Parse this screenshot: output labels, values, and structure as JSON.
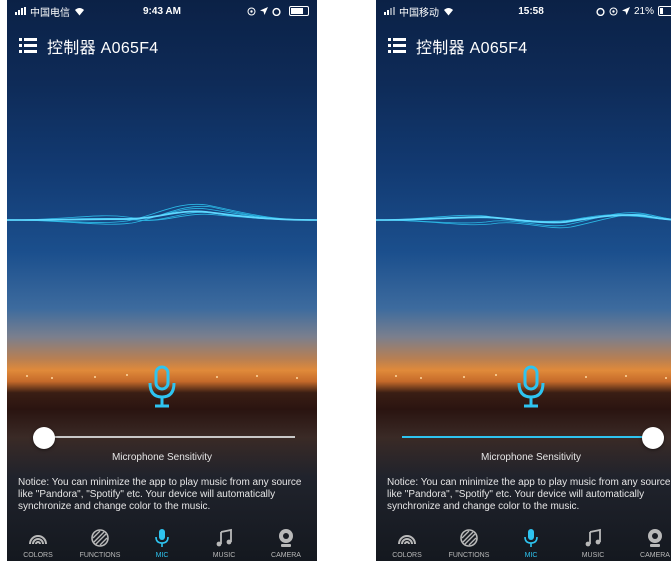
{
  "colors": {
    "accent": "#2ec4f0",
    "tab_inactive": "#b9b9b9",
    "track": "#c8c8c8"
  },
  "screens": [
    {
      "status": {
        "carrier": "中国电信",
        "time": "9:43 AM",
        "battery_percent": "",
        "battery_level": 0.85
      },
      "header": {
        "title": "控制器 A065F4",
        "menu_icon": "list-icon"
      },
      "mic": {
        "icon": "microphone-icon",
        "sensitivity_label": "Microphone Sensitivity",
        "sensitivity": 0.0
      },
      "notice": "Notice: You can minimize the app to play music from any source like \"Pandora\", \"Spotify\" etc. Your device will automatically synchronize and change color to the music.",
      "tabs": [
        {
          "label": "COLORS",
          "icon": "rainbow-icon",
          "active": false
        },
        {
          "label": "FUNCTIONS",
          "icon": "striped-circle-icon",
          "active": false
        },
        {
          "label": "MIC",
          "icon": "microphone-icon",
          "active": true
        },
        {
          "label": "MUSIC",
          "icon": "music-note-icon",
          "active": false
        },
        {
          "label": "CAMERA",
          "icon": "webcam-icon",
          "active": false
        }
      ]
    },
    {
      "status": {
        "carrier": "中国移动",
        "time": "15:58",
        "battery_percent": "21%",
        "battery_level": 0.21
      },
      "header": {
        "title": "控制器 A065F4",
        "menu_icon": "list-icon"
      },
      "mic": {
        "icon": "microphone-icon",
        "sensitivity_label": "Microphone Sensitivity",
        "sensitivity": 1.0
      },
      "notice": "Notice: You can minimize the app to play music from any source like \"Pandora\", \"Spotify\" etc. Your device will automatically synchronize and change color to the music.",
      "tabs": [
        {
          "label": "COLORS",
          "icon": "rainbow-icon",
          "active": false
        },
        {
          "label": "FUNCTIONS",
          "icon": "striped-circle-icon",
          "active": false
        },
        {
          "label": "MIC",
          "icon": "microphone-icon",
          "active": true
        },
        {
          "label": "MUSIC",
          "icon": "music-note-icon",
          "active": false
        },
        {
          "label": "CAMERA",
          "icon": "webcam-icon",
          "active": false
        }
      ]
    }
  ]
}
